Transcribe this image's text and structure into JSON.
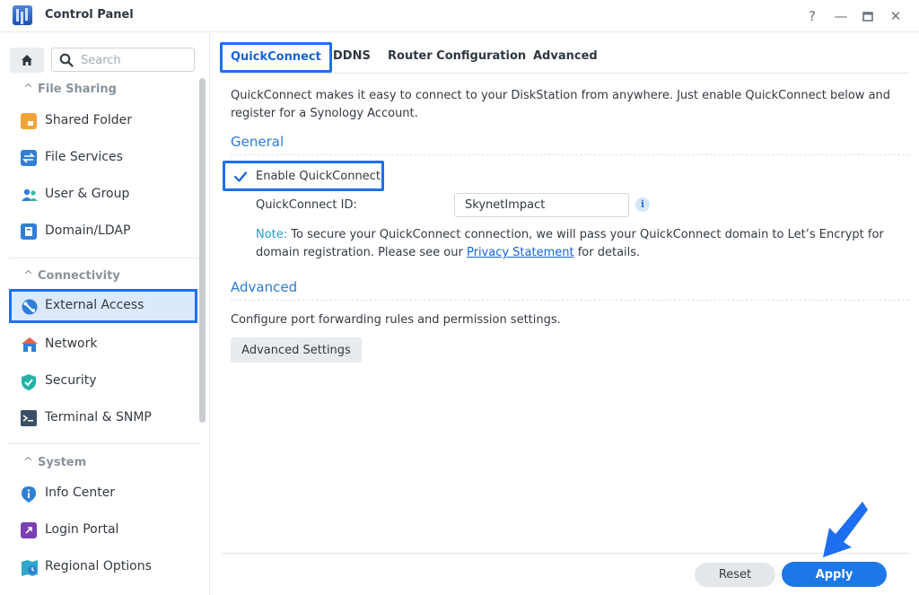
{
  "window": {
    "title": "Control Panel",
    "controls": [
      "?",
      "—",
      "▭",
      "✕"
    ]
  },
  "sidebar": {
    "search_placeholder": "Search",
    "sections": [
      {
        "title": "File Sharing",
        "items": [
          {
            "label": "Shared Folder",
            "icon": "shared-folder-icon"
          },
          {
            "label": "File Services",
            "icon": "file-services-icon"
          },
          {
            "label": "User & Group",
            "icon": "user-group-icon"
          },
          {
            "label": "Domain/LDAP",
            "icon": "domain-ldap-icon"
          }
        ]
      },
      {
        "title": "Connectivity",
        "items": [
          {
            "label": "External Access",
            "icon": "external-access-icon",
            "active": true
          },
          {
            "label": "Network",
            "icon": "network-icon"
          },
          {
            "label": "Security",
            "icon": "security-shield-icon"
          },
          {
            "label": "Terminal & SNMP",
            "icon": "terminal-icon"
          }
        ]
      },
      {
        "title": "System",
        "items": [
          {
            "label": "Info Center",
            "icon": "info-center-icon"
          },
          {
            "label": "Login Portal",
            "icon": "login-portal-icon"
          },
          {
            "label": "Regional Options",
            "icon": "regional-options-icon"
          }
        ]
      }
    ]
  },
  "tabs": [
    {
      "label": "QuickConnect",
      "active": true
    },
    {
      "label": "DDNS"
    },
    {
      "label": "Router Configuration"
    },
    {
      "label": "Advanced"
    }
  ],
  "quickconnect": {
    "intro": "QuickConnect makes it easy to connect to your DiskStation from anywhere. Just enable QuickConnect below and register for a Synology Account.",
    "general_title": "General",
    "enable_label": "Enable QuickConnect",
    "enabled": true,
    "id_label": "QuickConnect ID:",
    "id_value": "SkynetImpact",
    "note_key": "Note:",
    "note_text_1": " To secure your QuickConnect connection, we will pass your QuickConnect domain to Let’s Encrypt for domain registration. Please see our ",
    "note_link": "Privacy Statement",
    "note_text_2": " for details.",
    "advanced_title": "Advanced",
    "advanced_desc": "Configure port forwarding rules and permission settings.",
    "advanced_button": "Advanced Settings"
  },
  "footer": {
    "reset_label": "Reset",
    "apply_label": "Apply"
  },
  "colors": {
    "accent": "#1e77e6",
    "highlight_border": "#1e6ff0",
    "section_title": "#2b7bd8"
  }
}
